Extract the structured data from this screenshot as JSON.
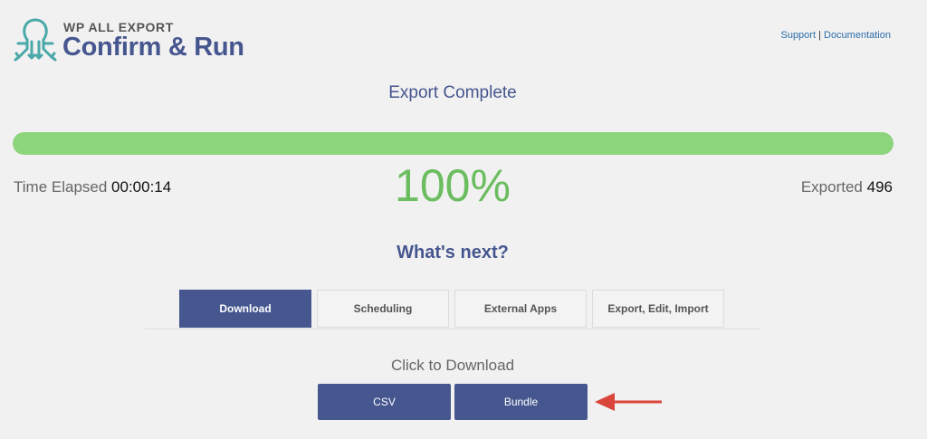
{
  "header": {
    "brand": "WP ALL EXPORT",
    "title": "Confirm & Run",
    "links": {
      "support": "Support",
      "separator": "|",
      "documentation": "Documentation"
    }
  },
  "status": {
    "title": "Export Complete",
    "progress": 1.0,
    "percent": "100%",
    "time_label": "Time Elapsed",
    "time_value": "00:00:14",
    "exported_label": "Exported",
    "exported_value": "496"
  },
  "next": {
    "heading": "What's next?",
    "tabs": [
      {
        "label": "Download",
        "active": true
      },
      {
        "label": "Scheduling",
        "active": false
      },
      {
        "label": "External Apps",
        "active": false
      },
      {
        "label": "Export, Edit, Import",
        "active": false
      }
    ]
  },
  "download": {
    "label": "Click to Download",
    "buttons": [
      {
        "label": "CSV"
      },
      {
        "label": "Bundle"
      }
    ]
  },
  "colors": {
    "accent": "#46568f",
    "progress": "#8cd57c",
    "percent": "#6bbd60",
    "logo": "#4aa8a9",
    "arrow": "#d9453a"
  },
  "icons": {
    "logo": "octopus-logo-icon",
    "annotation": "arrow-left-icon"
  }
}
